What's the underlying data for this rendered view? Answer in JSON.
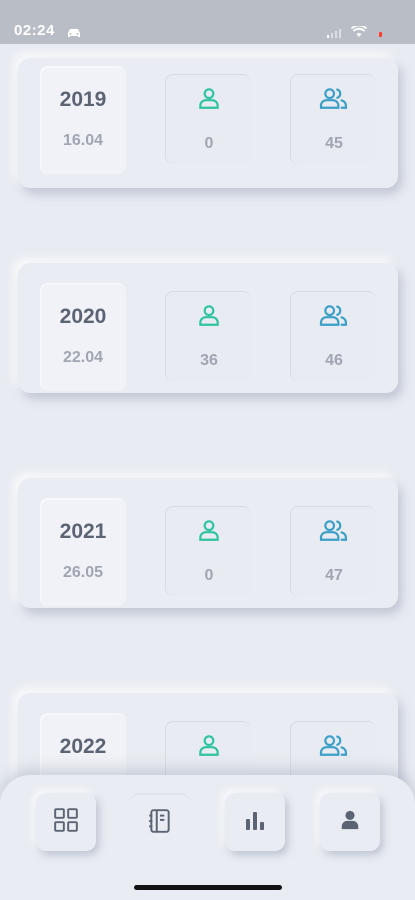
{
  "status_bar": {
    "time": "02:24"
  },
  "records": [
    {
      "year": "2019",
      "date": "16.04",
      "single": "0",
      "group": "45"
    },
    {
      "year": "2020",
      "date": "22.04",
      "single": "36",
      "group": "46"
    },
    {
      "year": "2021",
      "date": "26.05",
      "single": "0",
      "group": "47"
    },
    {
      "year": "2022",
      "date": "",
      "single": "",
      "group": ""
    }
  ],
  "colors": {
    "single_icon": "#2ec4a0",
    "group_icon": "#3aa0c8"
  },
  "nav": {
    "items": [
      {
        "icon": "grid-icon",
        "active": false
      },
      {
        "icon": "notebook-icon",
        "active": true
      },
      {
        "icon": "bar-chart-icon",
        "active": false
      },
      {
        "icon": "user-icon",
        "active": false
      }
    ]
  }
}
